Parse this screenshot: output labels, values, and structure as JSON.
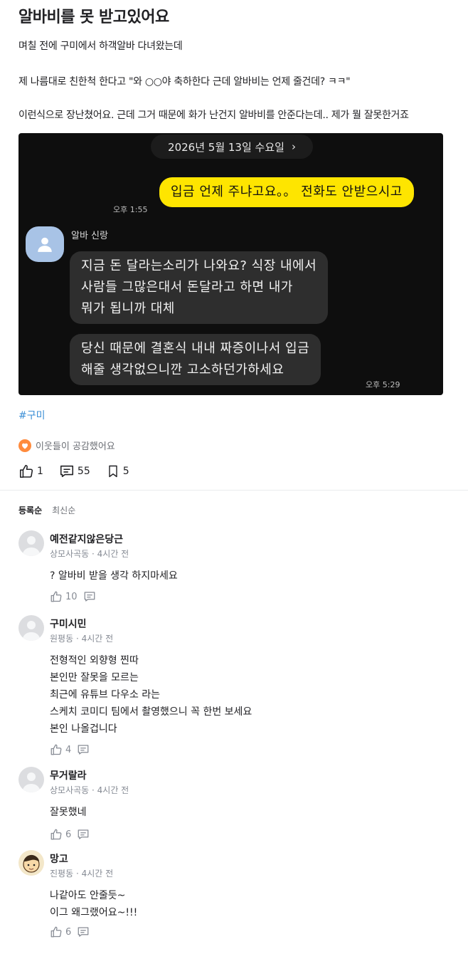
{
  "post": {
    "title": "알바비를 못 받고있어요",
    "paragraphs": [
      "며칠 전에 구미에서 하객알바 다녀왔는데",
      "제 나름대로 친한척 한다고 \"와 ○○야 축하한다 근데 알바비는 언제 줄건데? ㅋㅋ\"",
      "이런식으로 장난쳤어요. 근데 그거 때문에 화가 난건지 알바비를 안준다는데.. 제가 뭘 잘못한거죠"
    ],
    "hashtag": "#구미",
    "empathy_text": "이웃들이 공감했어요",
    "likes": "1",
    "comments": "55",
    "bookmarks": "5"
  },
  "chat": {
    "date": "2026년 5월 13일 수요일",
    "date_arrow": "›",
    "my_message": "입금 언제 주냐고요。。 전화도 안받으시고",
    "my_time": "오후 1:55",
    "sender": "알바 신랑",
    "reply1_lines": [
      "지금 돈 달라는소리가 나와요? 식장 내에서",
      "사람들 그많은대서 돈달라고 하면 내가",
      "뭐가 됩니까 대체"
    ],
    "reply2_lines": [
      "당신 때문에 결혼식 내내 짜증이나서 입금",
      "해줄 생각없으니깐 고소하던가하세요"
    ],
    "reply_time": "오후 5:29"
  },
  "sort": {
    "registered": "등록순",
    "latest": "최신순"
  },
  "comments": [
    {
      "name": "예전같지않은당근",
      "location": "상모사곡동",
      "time": "4시간 전",
      "lines": [
        "? 알바비 받을 생각 하지마세요"
      ],
      "likes": "10"
    },
    {
      "name": "구미시민",
      "location": "원평동",
      "time": "4시간 전",
      "lines": [
        "전형적인 외향형 찐따",
        "본인만 잘못을 모르는",
        "최근에 유튜브 다우소 라는",
        "스케치 코미디 팀에서 촬영했으니 꼭 한번 보세요",
        "본인 나올겁니다"
      ],
      "likes": "4"
    },
    {
      "name": "무거랄라",
      "location": "상모사곡동",
      "time": "4시간 전",
      "lines": [
        "잘못했네"
      ],
      "likes": "6"
    },
    {
      "name": "망고",
      "location": "진평동",
      "time": "4시간 전",
      "lines": [
        "나같아도 안줄듯~",
        "이그 왜그랬어요~!!!"
      ],
      "likes": "6"
    }
  ],
  "meta_separator": " · ",
  "colors": {
    "kakao_yellow": "#fee500",
    "hashtag_blue": "#3c8fd6",
    "empathy_orange": "#ff8b3d"
  }
}
